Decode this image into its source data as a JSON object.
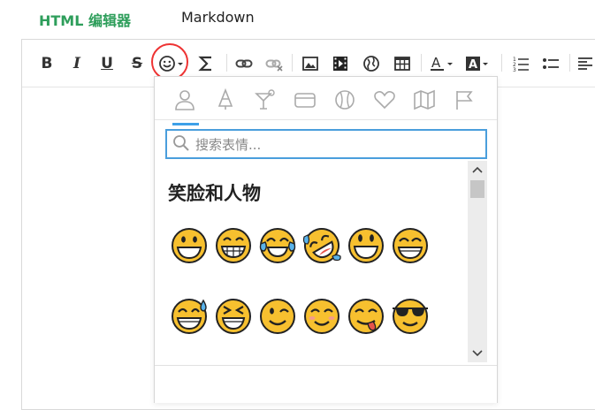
{
  "tabs": {
    "html_editor": "HTML 编辑器",
    "markdown": "Markdown"
  },
  "toolbar": {
    "bold": "B",
    "italic": "I",
    "underline": "U",
    "strikethrough": "S",
    "emoji_icon": "smiley-icon",
    "formula_icon": "sigma-icon"
  },
  "emoji_panel": {
    "categories": [
      "person-icon",
      "tree-icon",
      "cocktail-icon",
      "card-icon",
      "ball-icon",
      "heart-icon",
      "map-icon",
      "flag-icon"
    ],
    "search_placeholder": "搜索表情...",
    "section_title": "笑脸和人物",
    "row1": [
      "grinning",
      "grin",
      "joy",
      "rofl",
      "smiley",
      "smile"
    ],
    "row2": [
      "sweat-smile",
      "laughing",
      "wink",
      "blush",
      "yum",
      "sunglasses"
    ]
  },
  "colors": {
    "active_tab": "#2e9e5b",
    "accent": "#3da0e8",
    "highlight": "#e33333",
    "emoji_fill": "#f7c02f"
  }
}
